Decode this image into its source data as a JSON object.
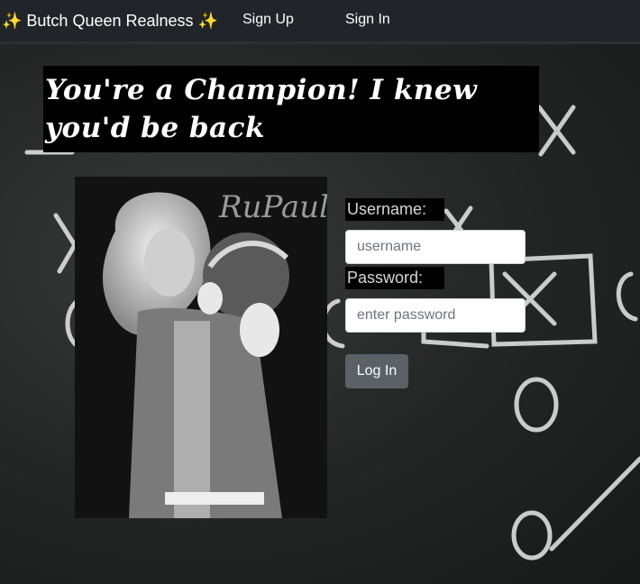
{
  "navbar": {
    "brand": "✨ Butch Queen Realness ✨",
    "signup_label": "Sign Up",
    "signin_label": "Sign In"
  },
  "main": {
    "headline": "You're a Champion! I knew you'd be back",
    "photo_alt": "RuPaul Champion",
    "logo_text": "RuPaul"
  },
  "form": {
    "username_label": "Username:",
    "username_placeholder": "username",
    "password_label": "Password:",
    "password_placeholder": "enter password",
    "login_label": "Log In"
  },
  "colors": {
    "navbar_bg": "#212529",
    "button_bg": "#5a6268",
    "label_bg": "#000000"
  }
}
